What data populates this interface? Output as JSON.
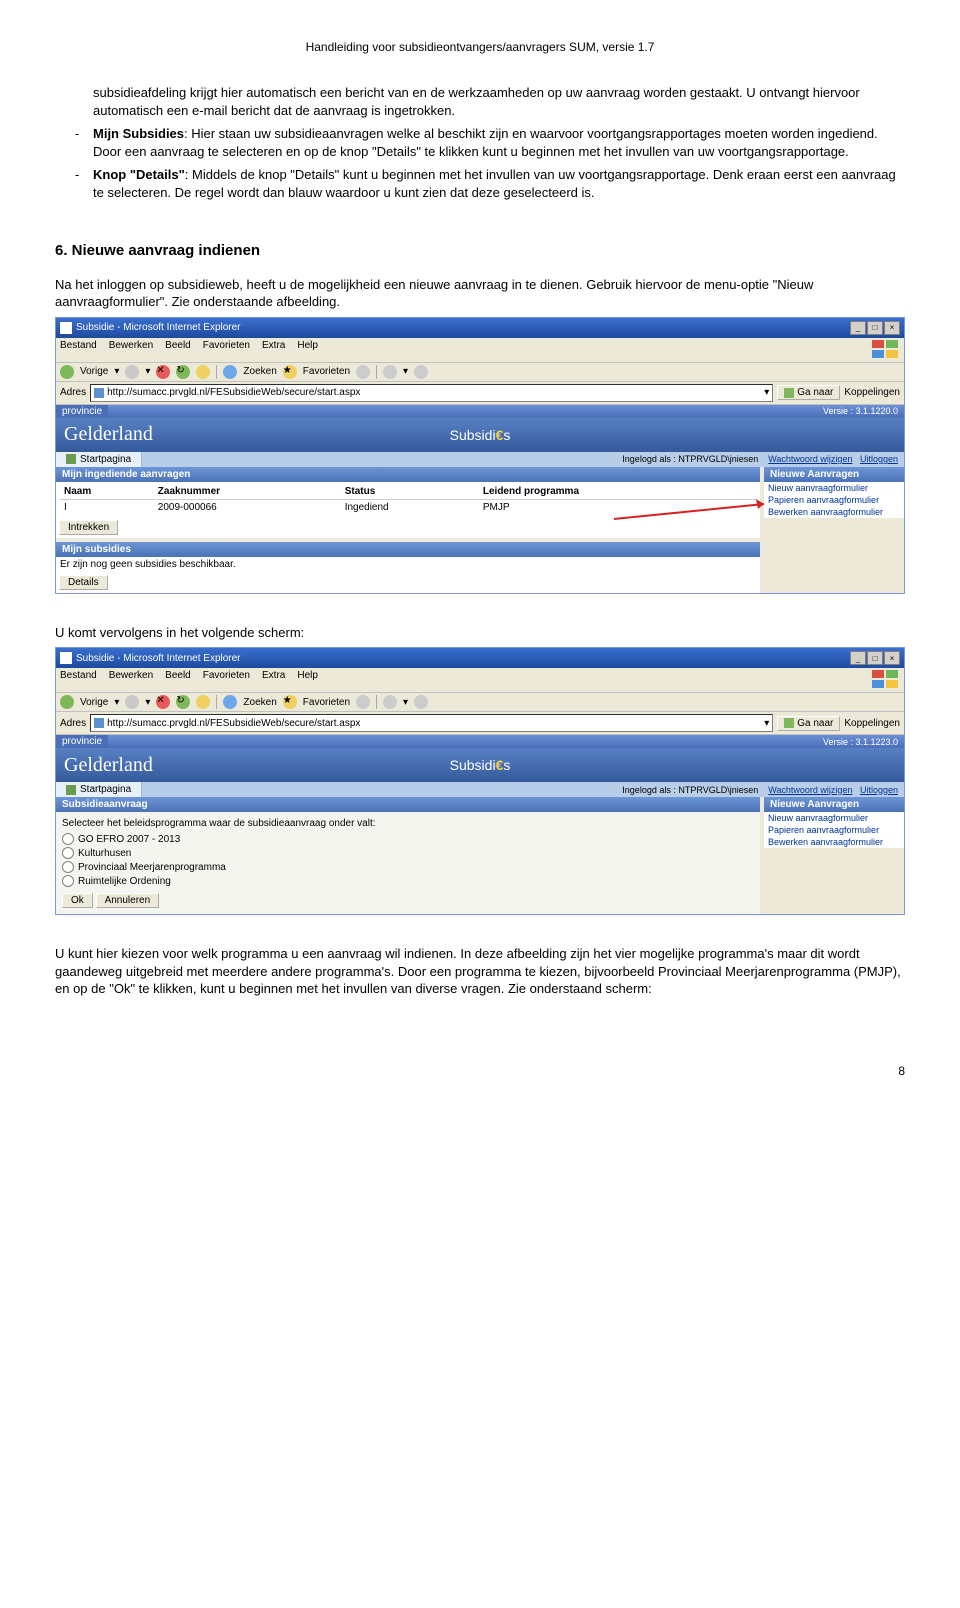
{
  "doc": {
    "header": "Handleiding voor subsidieontvangers/aanvragers SUM, versie 1.7",
    "page_number": "8",
    "para0_indent": "subsidieafdeling krijgt hier automatisch een bericht van en de werkzaamheden op uw aanvraag worden gestaakt. U ontvangt hiervoor automatisch een e-mail bericht dat de aanvraag is ingetrokken.",
    "bullet1_bold": "Mijn Subsidies",
    "bullet1_rest": ": Hier staan uw subsidieaanvragen welke al beschikt zijn en waarvoor voortgangsrapportages moeten worden ingediend. Door een aanvraag te selecteren en op de knop \"Details\" te klikken kunt u beginnen met het invullen van uw voortgangsrapportage.",
    "bullet2_bold": "Knop \"Details\"",
    "bullet2_rest": ": Middels de knop \"Details\" kunt u beginnen met het invullen van uw voortgangsrapportage. Denk eraan eerst een aanvraag te selecteren. De regel wordt dan blauw waardoor u kunt zien dat deze geselecteerd is.",
    "section6_title": "6.   Nieuwe aanvraag indienen",
    "section6_intro": "Na het inloggen op subsidieweb, heeft u de mogelijkheid een nieuwe aanvraag in te dienen. Gebruik hiervoor de menu-optie \"Nieuw aanvraagformulier\". Zie onderstaande afbeelding.",
    "followup1": "U komt vervolgens in het volgende scherm:",
    "closing": "U kunt hier kiezen voor welk programma u een aanvraag wil indienen. In deze afbeelding zijn het vier mogelijke programma's maar dit wordt gaandeweg uitgebreid met meerdere andere programma's. Door een programma te kiezen, bijvoorbeeld Provinciaal Meerjarenprogramma (PMJP), en op de \"Ok\" te klikken, kunt u beginnen met het invullen van diverse vragen. Zie onderstaand scherm:"
  },
  "ie": {
    "title": "Subsidie - Microsoft Internet Explorer",
    "menu": {
      "bestand": "Bestand",
      "bewerken": "Bewerken",
      "beeld": "Beeld",
      "favorieten": "Favorieten",
      "extra": "Extra",
      "help": "Help"
    },
    "toolbar": {
      "vorige": "Vorige",
      "zoeken": "Zoeken",
      "fav": "Favorieten"
    },
    "address_label": "Adres",
    "url": "http://sumacc.prvgld.nl/FESubsidieWeb/secure/start.aspx",
    "go": "Ga naar",
    "links": "Koppelingen"
  },
  "app": {
    "provincie": "provincie",
    "brand": "Gelderland",
    "version1": "Versie : 3.1.1220.0",
    "version2": "Versie : 3.1.1223.0",
    "center_logo_pre": "Subsidi",
    "center_logo_euro": "€",
    "center_logo_post": "s",
    "tab_start": "Startpagina",
    "logged_as_label": "Ingelogd als :",
    "logged_as_user": "NTPRVGLD\\jniesen",
    "pw_change": "Wachtwoord wijzigen",
    "logout": "Uitloggen"
  },
  "panel1": {
    "hdr": "Mijn ingediende aanvragen",
    "cols": {
      "naam": "Naam",
      "zaak": "Zaaknummer",
      "status": "Status",
      "prog": "Leidend programma"
    },
    "row": {
      "naam": "I",
      "zaak": "2009-000066",
      "status": "Ingediend",
      "prog": "PMJP"
    },
    "btn_intrekken": "Intrekken",
    "hdr2": "Mijn subsidies",
    "empty": "Er zijn nog geen subsidies beschikbaar.",
    "btn_details": "Details"
  },
  "sidebox": {
    "hdr": "Nieuwe Aanvragen",
    "item1": "Nieuw aanvraagformulier",
    "item2": "Papieren aanvraagformulier",
    "item3": "Bewerken aanvraagformulier"
  },
  "panel2": {
    "hdr": "Subsidieaanvraag",
    "instruction": "Selecteer het beleidsprogramma waar de subsidieaanvraag onder valt:",
    "opt1": "GO EFRO 2007 - 2013",
    "opt2": "Kulturhusen",
    "opt3": "Provinciaal Meerjarenprogramma",
    "opt4": "Ruimtelijke Ordening",
    "ok": "Ok",
    "cancel": "Annuleren"
  }
}
